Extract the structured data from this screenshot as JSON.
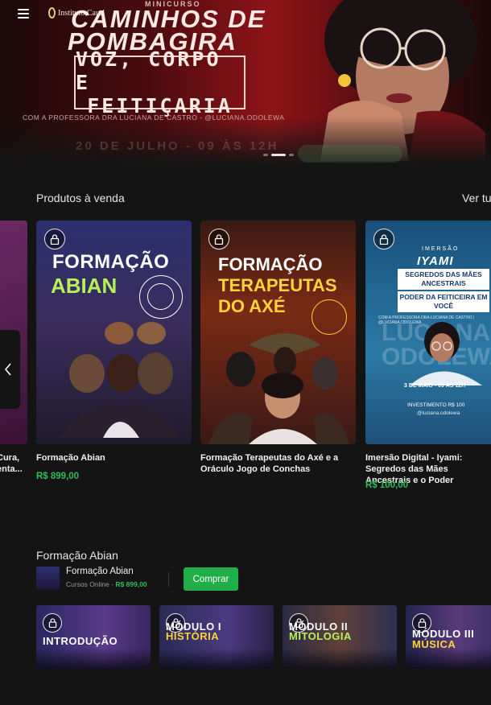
{
  "header": {
    "menu_icon": "hamburger-icon",
    "logo_text": "Instituto Cauri"
  },
  "hero": {
    "pre_title": "MINICURSO",
    "title_line1": "CAMINHOS DE",
    "title_line2": "POMBAGIRA",
    "box_line1": "VOZ, CORPO E",
    "box_line2": "FEITIÇARIA",
    "credit": "COM A PROFESSORA DRA LUCIANA DE CASTRO - @LUCIANA.ODOLEWA",
    "date": "20 DE JULHO - 09 ÀS 12H",
    "slides": 3,
    "active_slide": 1
  },
  "products_section": {
    "title": "Produtos à venda",
    "see_all": "Ver tu",
    "partial_left_name_line1": "Cura,",
    "partial_left_name_line2": "enta...",
    "items": [
      {
        "name": "Formação Abian",
        "price": "R$ 899,00",
        "art_line1": "FORMAÇÃO",
        "art_line2": "ABIAN"
      },
      {
        "name": "Formação Terapeutas do Axé e a Oráculo Jogo de Conchas",
        "price": "",
        "art_line1": "FORMAÇÃO",
        "art_line2": "TERAPEUTAS",
        "art_line3": "DO AXÉ"
      },
      {
        "name": "Imersão Digital - Iyami: Segredos das Mães Ancestrais e o Poder",
        "price": "R$ 100,00",
        "art_pre": "IMERSÃO",
        "art_title": "IYAMI",
        "art_box1": "SEGREDOS DAS MÃES ANCESTRAIS",
        "art_box2": "PODER DA FEITICEIRA EM VOCÊ",
        "art_credit": "COM A PROFESSORA DRA LUCIANA DE CASTRO | @LUCIANA.ODOLEWA",
        "art_bg": "LUCIANA ODOLEWA",
        "art_date": "3 DE MAIO - 09 ÀS 12H",
        "art_invest": "INVESTIMENTO R$ 100",
        "art_handle": "@luciana.odolewa"
      }
    ]
  },
  "course_section": {
    "title": "Formação Abian",
    "product_name": "Formação Abian",
    "product_category": "Cursos Online",
    "product_price": "R$ 899,00",
    "buy_label": "Comprar",
    "modules": [
      {
        "label": "INTRODUÇÃO"
      },
      {
        "label_line1": "MÓDULO I",
        "label_line2": "HISTÓRIA"
      },
      {
        "label_line1": "MÓDULO II",
        "label_line2": "MITOLOGIA"
      },
      {
        "label_line1": "MÓDULO III",
        "label_line2": "MÚSICA"
      }
    ]
  },
  "colors": {
    "background": "#141414",
    "price_green": "#2fbd5a",
    "buy_button": "#1fae47",
    "hero_red": "#8e1418"
  }
}
